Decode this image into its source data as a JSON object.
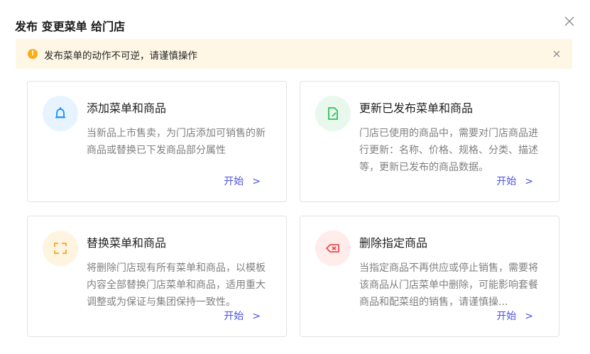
{
  "dialog": {
    "title": "发布 变更菜单 给门店",
    "close_icon": "close-icon"
  },
  "warning": {
    "icon": "exclamation-circle-icon",
    "text": "发布菜单的动作不可逆，请谨慎操作",
    "close_icon": "close-icon"
  },
  "cards": [
    {
      "icon": "bell-icon",
      "icon_bg": "#e7f4ff",
      "icon_color": "#1890ff",
      "title": "添加菜单和商品",
      "description": "当新品上市售卖，为门店添加可销售的新商品或替换已下发商品部分属性",
      "action_label": "开始",
      "action_icon": "chevron-right-icon"
    },
    {
      "icon": "file-edit-icon",
      "icon_bg": "#e8f8ec",
      "icon_color": "#2fbf5a",
      "title": "更新已发布菜单和商品",
      "description": "门店已使用的商品中，需要对门店商品进行更新：名称、价格、规格、分类、描述等，更新已发布的商品数据。",
      "action_label": "开始",
      "action_icon": "chevron-right-icon"
    },
    {
      "icon": "swap-icon",
      "icon_bg": "#fff4e0",
      "icon_color": "#f5a623",
      "title": "替换菜单和商品",
      "description": "将删除门店现有所有菜单和商品，以模板内容全部替换门店菜单和商品，适用重大调整或为保证与集团保持一致性。",
      "action_label": "开始",
      "action_icon": "chevron-right-icon"
    },
    {
      "icon": "delete-tag-icon",
      "icon_bg": "#ffeceb",
      "icon_color": "#f04a4a",
      "title": "删除指定商品",
      "description": "当指定商品不再供应或停止销售，需要将该商品从门店菜单中删除，可能影响套餐商品和配菜组的销售，请谨慎操...",
      "action_label": "开始",
      "action_icon": "chevron-right-icon"
    }
  ]
}
